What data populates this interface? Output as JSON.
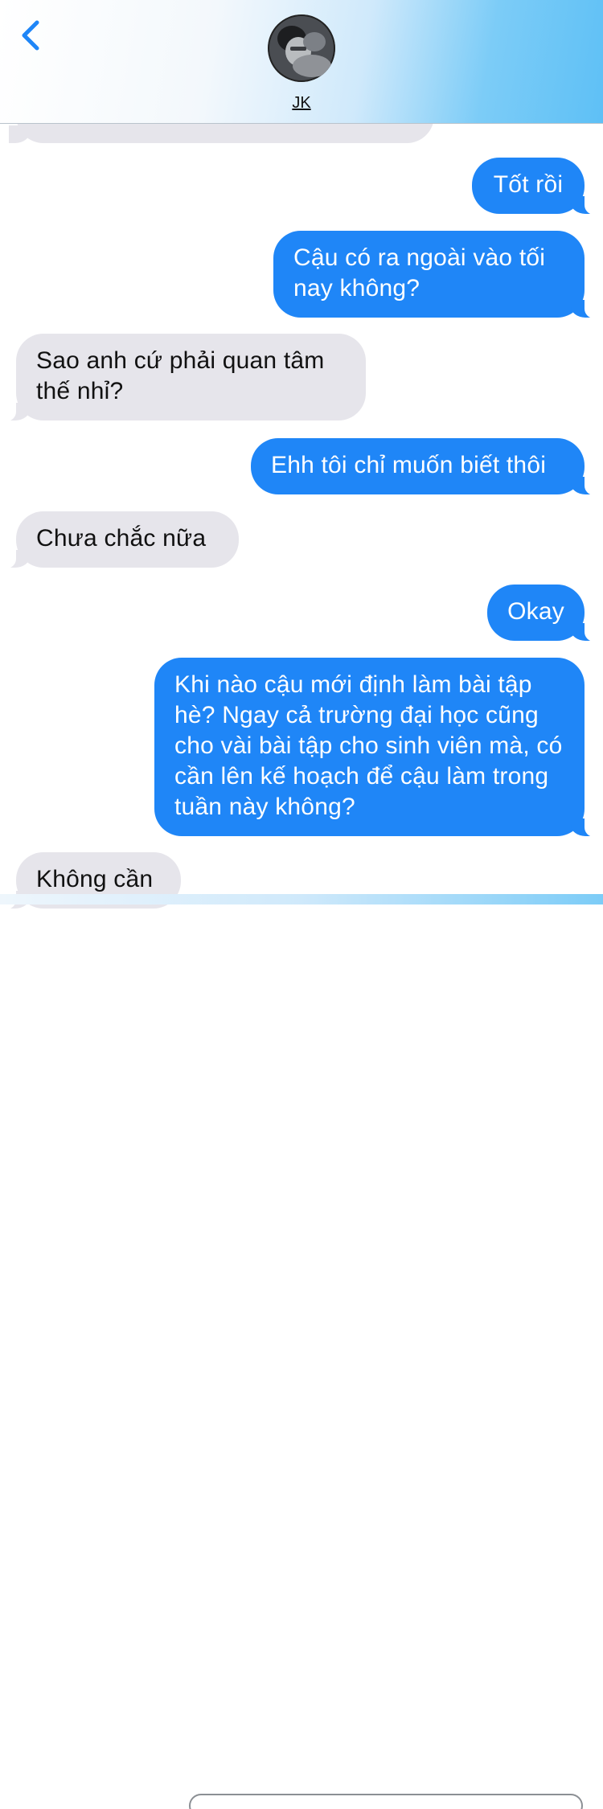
{
  "header": {
    "contact_name": "JK",
    "back_icon": "chevron-left-icon",
    "accent_color": "#1f86f7"
  },
  "messages": [
    {
      "direction": "sent",
      "text": "Tốt rồi"
    },
    {
      "direction": "sent",
      "text": "Cậu có ra ngoài vào tối nay không?"
    },
    {
      "direction": "received",
      "text": "Sao anh cứ phải quan tâm thế nhỉ?"
    },
    {
      "direction": "sent",
      "text": "Ehh tôi chỉ muốn biết thôi"
    },
    {
      "direction": "received",
      "text": "Chưa chắc nữa"
    },
    {
      "direction": "sent",
      "text": "Okay"
    },
    {
      "direction": "sent",
      "text": "Khi nào cậu mới định làm bài tập hè? Ngay cả trường đại học cũng cho vài bài tập cho sinh viên mà, có cần lên kế hoạch để cậu làm trong tuần này không?"
    },
    {
      "direction": "received",
      "text": "Không cần"
    }
  ],
  "colors": {
    "sent_bubble": "#1f86f7",
    "received_bubble": "#e6e5eb"
  }
}
